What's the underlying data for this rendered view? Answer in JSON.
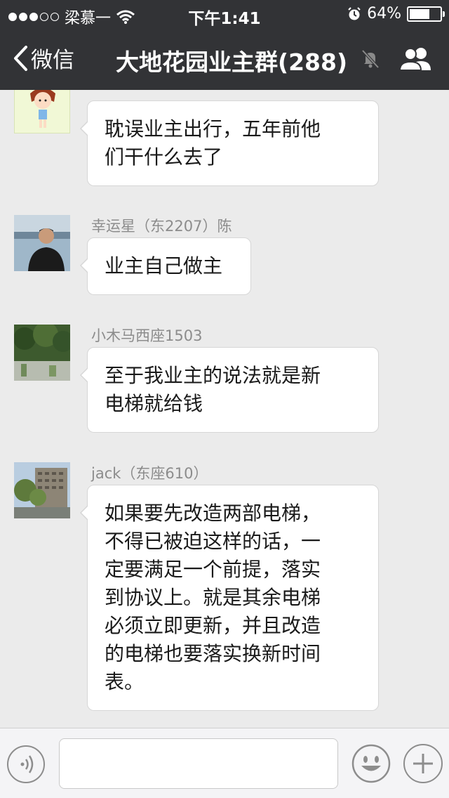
{
  "status_bar": {
    "carrier": "梁慕一",
    "time": "下午1:41",
    "battery": "64%"
  },
  "nav": {
    "back_label": "微信",
    "title": "大地花园业主群(288)"
  },
  "messages": [
    {
      "sender": "",
      "text_lines": [
        "耽误业主出行，五年前他",
        "们干什么去了"
      ],
      "avatar": "cartoon-girl"
    },
    {
      "sender": "幸运星（东2207）陈",
      "text_lines": [
        "业主自己做主"
      ],
      "avatar": "man-photo"
    },
    {
      "sender": "小木马西座1503",
      "text_lines": [
        "至于我业主的说法就是新",
        "电梯就给钱"
      ],
      "avatar": "trees-photo"
    },
    {
      "sender": "jack（东座610）",
      "text_lines": [
        "如果要先改造两部电梯，",
        "不得已被迫这样的话，一",
        "定要满足一个前提，落实",
        "到协议上。就是其余电梯",
        "必须立即更新，并且改造",
        "的电梯也要落实换新时间",
        "表。"
      ],
      "avatar": "building-photo"
    }
  ],
  "input_bar": {
    "placeholder": ""
  },
  "colors": {
    "nav_background": "#323336",
    "chat_background": "#ebebeb",
    "bubble_background": "#ffffff",
    "sender_text": "#8c8c8c"
  }
}
